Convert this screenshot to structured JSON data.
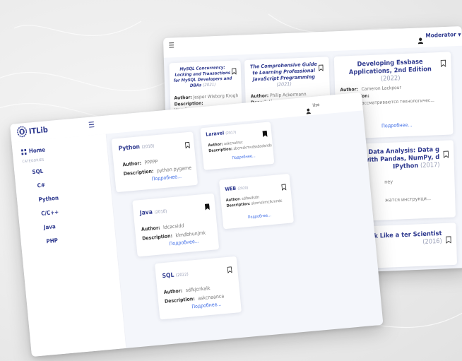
{
  "back": {
    "role_label": "Moderator",
    "user_short": "Use",
    "books": [
      {
        "title": "MySQL Concurrency: Locking and Transactions for MySQL Developers and DBAs",
        "year": "(2021)",
        "author": "Jesper Wisborg Krogh",
        "description": "Узнайте, как работают блокировки в My..."
      },
      {
        "title": "The Comprehensive Guide to Learning Professional JavaScript Programming",
        "year": "(2021)",
        "author": "Philip Ackermann",
        "description": ""
      },
      {
        "title": "Developing Essbase Applications, 2nd Edition",
        "year": "(2022)",
        "author": "Cameron Lackpour",
        "description": "В книге рассматриваются технологичес..."
      },
      {
        "title_partial": "n for Data Analysis: Data g with Pandas, NumPy, d IPython",
        "year": "(2017)",
        "author_partial": "ney",
        "description_partial": "жатся инструкци..."
      },
      {
        "title_partial": "to Think Like a ter Scientist",
        "year": "(2016)"
      }
    ],
    "more_label": "Подробнее..."
  },
  "front": {
    "logo_text": "ITLib",
    "sidebar": {
      "home_label": "Home",
      "categories_label": "CATEGORIES",
      "items": [
        "SQL",
        "C#",
        "Python",
        "C/C++",
        "Java",
        "PHP"
      ]
    },
    "labels": {
      "author": "Author:",
      "description": "Description:",
      "more": "Подробнее..."
    },
    "books": [
      {
        "title": "Python",
        "year": "(2018)",
        "author": "PPPPP",
        "description": "python pygame",
        "bookmarked": false
      },
      {
        "title": "Laravel",
        "year": "(2017)",
        "author": "askcnalnsc",
        "description": "zbcmskmvdssbsdsnds",
        "bookmarked": true
      },
      {
        "title": "Java",
        "year": "(2018)",
        "author": "Idcacsidd",
        "description": "klmdbhunjmk",
        "bookmarked": true
      },
      {
        "title": "WEB",
        "year": "(2020)",
        "author": "sdfasdsdn",
        "description": "sknmskmclkmndc",
        "bookmarked": false
      },
      {
        "title": "SQL",
        "year": "(2022)",
        "author": "sdfkjcnkalk",
        "description": "askcnaanca",
        "bookmarked": false
      }
    ]
  },
  "colors": {
    "accent": "#2f3a8f",
    "link": "#3c6be6"
  }
}
